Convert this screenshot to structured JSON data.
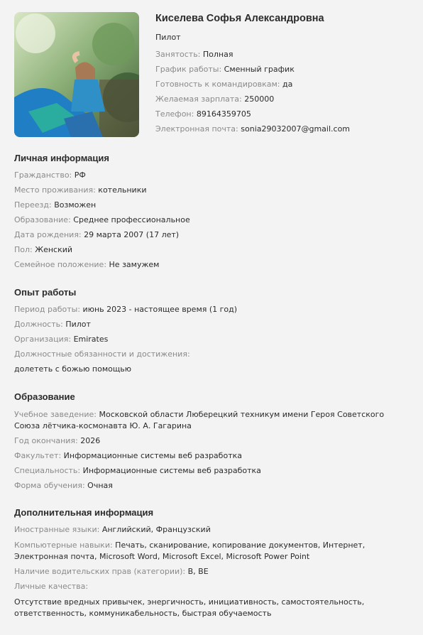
{
  "profile": {
    "name": "Киселева Софья Александровна",
    "position": "Пилот",
    "photo_alt": "profile-photo",
    "rows": [
      {
        "label": "Занятость:",
        "value": "Полная"
      },
      {
        "label": "График работы:",
        "value": "Сменный график"
      },
      {
        "label": "Готовность к командировкам:",
        "value": "да"
      },
      {
        "label": "Желаемая зарплата:",
        "value": "250000"
      },
      {
        "label": "Телефон:",
        "value": "89164359705"
      },
      {
        "label": "Электронная почта:",
        "value": "sonia29032007@gmail.com"
      }
    ]
  },
  "personal": {
    "title": "Личная информация",
    "rows": [
      {
        "label": "Гражданство:",
        "value": "РФ"
      },
      {
        "label": "Место проживания:",
        "value": "котельники"
      },
      {
        "label": "Переезд:",
        "value": "Возможен"
      },
      {
        "label": "Образование:",
        "value": "Среднее профессиональное"
      },
      {
        "label": "Дата рождения:",
        "value": "29 марта 2007 (17 лет)"
      },
      {
        "label": "Пол:",
        "value": "Женский"
      },
      {
        "label": "Семейное положение:",
        "value": "Не замужем"
      }
    ]
  },
  "experience": {
    "title": "Опыт работы",
    "rows": [
      {
        "label": "Период работы:",
        "value": "июнь 2023 - настоящее время (1 год)"
      },
      {
        "label": "Должность:",
        "value": "Пилот"
      },
      {
        "label": "Организация:",
        "value": "Emirates"
      },
      {
        "label": "Должностные обязанности и достижения:",
        "value": ""
      }
    ],
    "duties": "долететь с божью помощью"
  },
  "education": {
    "title": "Образование",
    "rows": [
      {
        "label": "Учебное заведение:",
        "value": "Московской области Люберецкий техникум имени Героя Советского Союза лётчика-космонавта Ю. А. Гагарина"
      },
      {
        "label": "Год окончания:",
        "value": "2026"
      },
      {
        "label": "Факультет:",
        "value": "Информационные системы веб разработка"
      },
      {
        "label": "Специальность:",
        "value": "Информационные системы веб разработка"
      },
      {
        "label": "Форма обучения:",
        "value": "Очная"
      }
    ]
  },
  "additional": {
    "title": "Дополнительная информация",
    "rows": [
      {
        "label": "Иностранные языки:",
        "value": "Английский, Французский"
      },
      {
        "label": "Компьютерные навыки:",
        "value": "Печать, сканирование, копирование документов, Интернет, Электронная почта, Microsoft Word, Microsoft Excel, Microsoft Power Point"
      },
      {
        "label": "Наличие водительских прав (категории):",
        "value": "B, BE"
      },
      {
        "label": "Личные качества:",
        "value": ""
      }
    ],
    "qualities": "Отсутствие вредных привычек, энергичность, инициативность, самостоятельность, ответственность, коммуникабельность, быстрая обучаемость"
  }
}
